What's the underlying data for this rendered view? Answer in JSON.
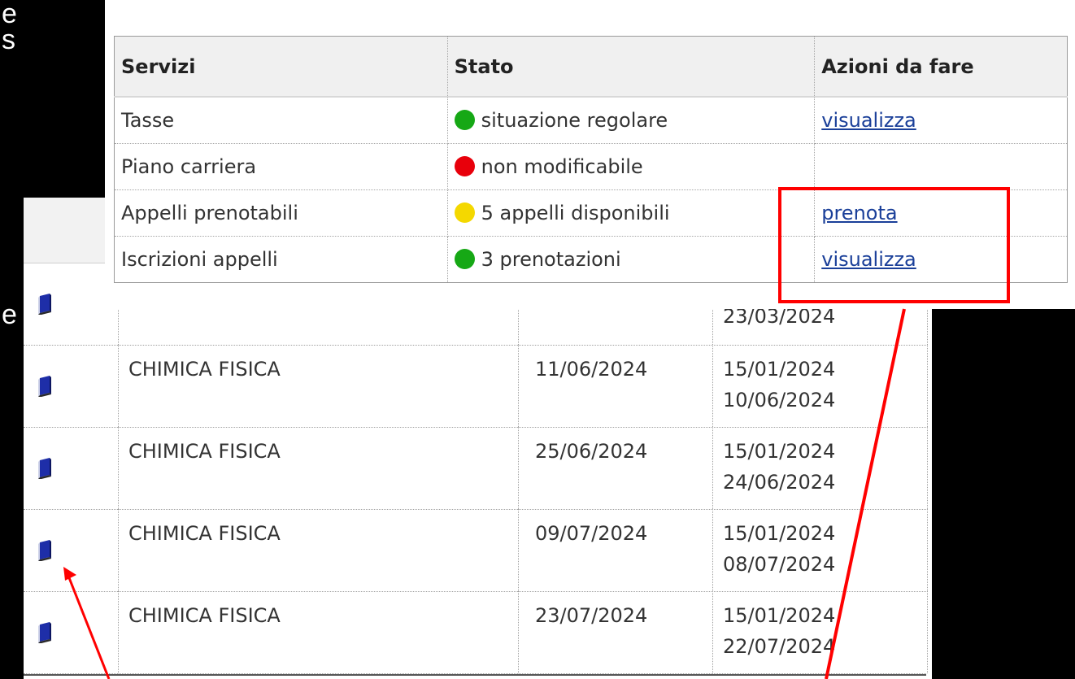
{
  "background_fragments": [
    "e",
    "s",
    "e"
  ],
  "services_table": {
    "headers": [
      "Servizi",
      "Stato",
      "Azioni da fare"
    ],
    "rows": [
      {
        "service": "Tasse",
        "status_color": "#16a815",
        "status": "situazione regolare",
        "action": "visualizza"
      },
      {
        "service": "Piano carriera",
        "status_color": "#e8000b",
        "status": "non modificabile",
        "action": ""
      },
      {
        "service": "Appelli prenotabili",
        "status_color": "#f4d800",
        "status": "5 appelli disponibili",
        "action": "prenota"
      },
      {
        "service": "Iscrizioni appelli",
        "status_color": "#16a815",
        "status": "3 prenotazioni",
        "action": "visualizza"
      }
    ]
  },
  "exams_table": {
    "rows": [
      {
        "icon": "book-icon",
        "exam": "",
        "date": "",
        "period_start": "",
        "period_end": "23/03/2024"
      },
      {
        "icon": "book-icon",
        "exam": "CHIMICA FISICA",
        "date": "11/06/2024",
        "period_start": "15/01/2024",
        "period_end": "10/06/2024"
      },
      {
        "icon": "book-icon",
        "exam": "CHIMICA FISICA",
        "date": "25/06/2024",
        "period_start": "15/01/2024",
        "period_end": "24/06/2024"
      },
      {
        "icon": "book-icon",
        "exam": "CHIMICA FISICA",
        "date": "09/07/2024",
        "period_start": "15/01/2024",
        "period_end": "08/07/2024"
      },
      {
        "icon": "book-icon",
        "exam": "CHIMICA FISICA",
        "date": "23/07/2024",
        "period_start": "15/01/2024",
        "period_end": "22/07/2024"
      }
    ]
  },
  "annotation_color": "#ff0000"
}
